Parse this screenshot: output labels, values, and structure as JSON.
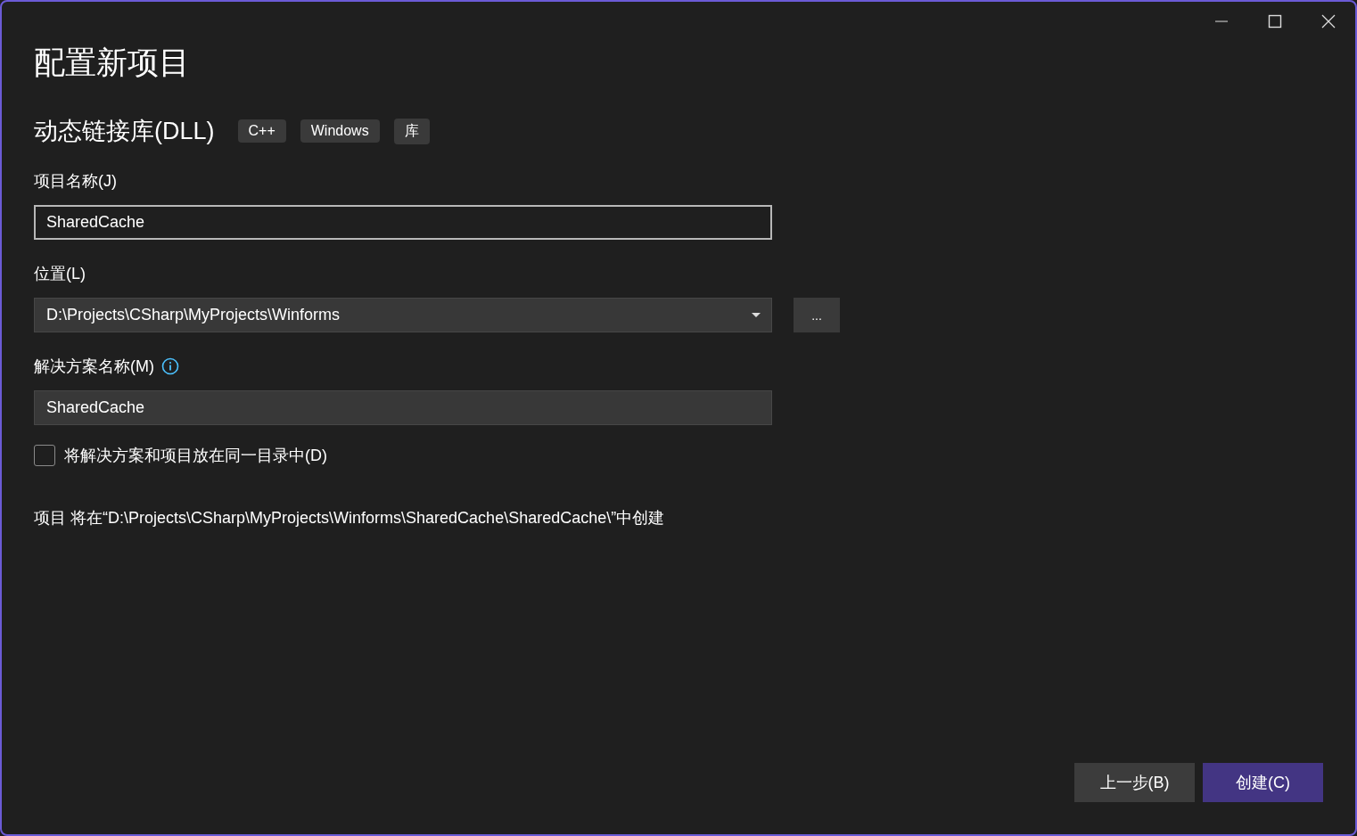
{
  "window": {
    "title": "配置新项目"
  },
  "template": {
    "name": "动态链接库(DLL)",
    "tags": [
      "C++",
      "Windows",
      "库"
    ]
  },
  "fields": [
    {
      "kind": "text",
      "label": "项目名称(J)",
      "value": "SharedCache",
      "focused": true,
      "info": false
    },
    {
      "kind": "dropdown",
      "label": "位置(L)",
      "value": "D:\\Projects\\CSharp\\MyProjects\\Winforms",
      "focused": false,
      "info": false,
      "browse": "..."
    },
    {
      "kind": "text",
      "label": "解决方案名称(M)",
      "value": "SharedCache",
      "focused": false,
      "info": true
    }
  ],
  "same_dir": {
    "label": "将解决方案和项目放在同一目录中(D)",
    "checked": false
  },
  "summary": "项目 将在“D:\\Projects\\CSharp\\MyProjects\\Winforms\\SharedCache\\SharedCache\\”中创建",
  "buttons": [
    {
      "label": "上一步(B)",
      "kind": "secondary"
    },
    {
      "label": "创建(C)",
      "kind": "primary"
    }
  ]
}
